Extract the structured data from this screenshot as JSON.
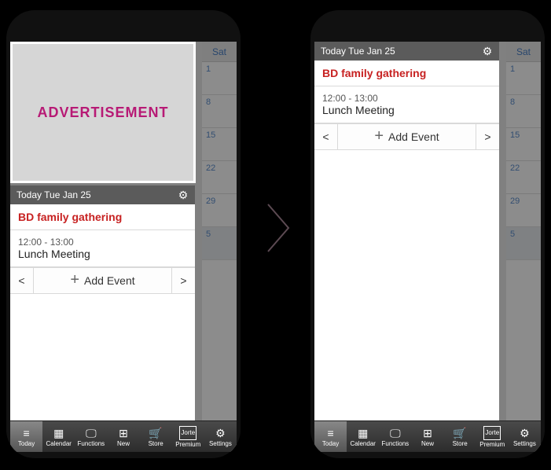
{
  "ad": {
    "label": "ADVERTISEMENT"
  },
  "today_bar": {
    "label": "Today Tue Jan 25"
  },
  "events": {
    "allday": "BD family gathering",
    "timed": {
      "time": "12:00 - 13:00",
      "title": "Lunch Meeting"
    }
  },
  "controls": {
    "prev": "<",
    "next": ">",
    "add": "Add Event"
  },
  "calbg": {
    "day_header": "Sat",
    "cells": [
      "1",
      "8",
      "15",
      "22",
      "29",
      "5"
    ]
  },
  "nav": {
    "today": "Today",
    "calendar": "Calendar",
    "functions": "Functions",
    "new": "New",
    "store": "Store",
    "premium": "Premium",
    "settings": "Settings"
  }
}
